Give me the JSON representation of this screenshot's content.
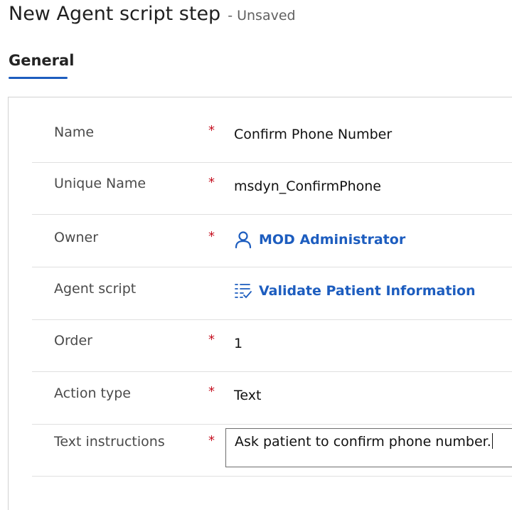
{
  "header": {
    "title": "New Agent script step",
    "status": "- Unsaved"
  },
  "tabs": [
    {
      "label": "General"
    }
  ],
  "form": {
    "name": {
      "label": "Name",
      "required": "*",
      "value": "Confirm Phone Number"
    },
    "unique_name": {
      "label": "Unique Name",
      "required": "*",
      "value": "msdyn_ConfirmPhone"
    },
    "owner": {
      "label": "Owner",
      "required": "*",
      "value": "MOD Administrator",
      "icon": "person-icon"
    },
    "agent_script": {
      "label": "Agent script",
      "value": "Validate Patient Information",
      "icon": "checklist-icon"
    },
    "order": {
      "label": "Order",
      "required": "*",
      "value": "1"
    },
    "action_type": {
      "label": "Action type",
      "required": "*",
      "value": "Text"
    },
    "text_instructions": {
      "label": "Text instructions",
      "required": "*",
      "value": "Ask patient to confirm phone number."
    }
  },
  "colors": {
    "link": "#1d5dbf",
    "required": "#c50f1f",
    "tab_underline": "#1d5dbf"
  }
}
